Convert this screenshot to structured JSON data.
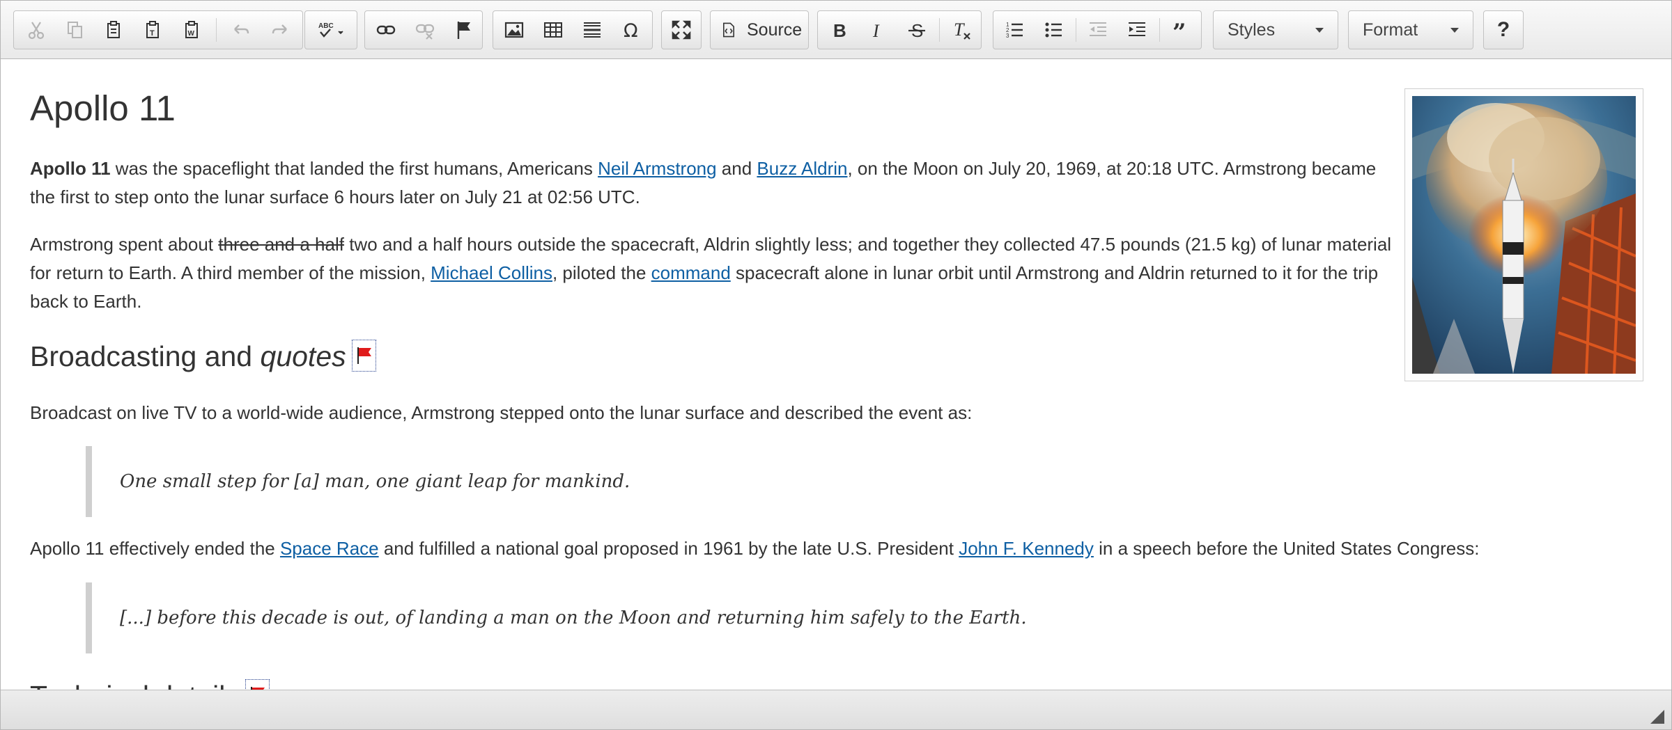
{
  "toolbar": {
    "source_label": "Source",
    "styles_label": "Styles",
    "format_label": "Format",
    "help_label": "?"
  },
  "document": {
    "title": "Apollo 11",
    "p1": {
      "bold": "Apollo 11",
      "t1": " was the spaceflight that landed the first humans, Americans ",
      "link1": "Neil Armstrong",
      "t2": " and ",
      "link2": "Buzz Aldrin",
      "t3": ", on the Moon on July 20, 1969, at 20:18 UTC. Armstrong became the first to step onto the lunar surface 6 hours later on July 21 at 02:56 UTC."
    },
    "p2": {
      "t1": "Armstrong spent about ",
      "strike": "three and a half",
      "t2": " two and a half hours outside the spacecraft, Aldrin slightly less; and together they collected 47.5 pounds (21.5 kg) of lunar material for return to Earth. A third member of the mission, ",
      "link1": "Michael Collins",
      "t3": ", piloted the ",
      "link2": "command",
      "t4": " spacecraft alone in lunar orbit until Armstrong and Aldrin returned to it for the trip back to Earth."
    },
    "h2_broadcast": {
      "text": "Broadcasting and ",
      "italic": "quotes"
    },
    "p3": "Broadcast on live TV to a world-wide audience, Armstrong stepped onto the lunar surface and described the event as:",
    "quote1": "One small step for [a] man, one giant leap for mankind.",
    "p4": {
      "t1": "Apollo 11 effectively ended the ",
      "link1": "Space Race",
      "t2": " and fulfilled a national goal proposed in 1961 by the late U.S. President ",
      "link2": "John F. Kennedy",
      "t3": " in a speech before the United States Congress:"
    },
    "quote2": "[...] before this decade is out, of landing a man on the Moon and returning him safely to the Earth.",
    "h2_technical": "Technical details"
  },
  "icons": {
    "cut": "cut-icon",
    "copy": "copy-icon",
    "paste": "paste-icon",
    "paste_text": "paste-text-icon",
    "paste_word": "paste-from-word-icon",
    "undo": "undo-icon",
    "redo": "redo-icon",
    "spellcheck": "spellcheck-icon",
    "link": "link-icon",
    "unlink": "unlink-icon",
    "anchor": "anchor-flag-icon",
    "image": "image-icon",
    "table": "table-icon",
    "hr": "horizontal-rule-icon",
    "special_char": "special-character-icon",
    "maximize": "maximize-icon",
    "source": "source-icon",
    "bold": "bold-icon",
    "italic": "italic-icon",
    "strike": "strikethrough-icon",
    "remove_format": "remove-format-icon",
    "numbered_list": "numbered-list-icon",
    "bulleted_list": "bulleted-list-icon",
    "outdent": "outdent-icon",
    "indent": "indent-icon",
    "blockquote": "blockquote-icon"
  }
}
